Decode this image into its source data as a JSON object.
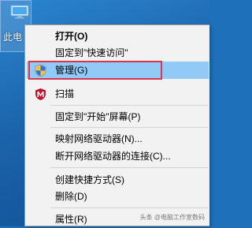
{
  "desktop": {
    "icon_label": "此电",
    "icon_name": "this-pc-icon"
  },
  "menu": {
    "items": [
      {
        "label": "打开(O)",
        "bold": true
      },
      {
        "label": "固定到\"快速访问\""
      },
      {
        "label": "管理(G)",
        "icon": "shield-icon",
        "highlighted": true
      },
      {
        "label": "扫描",
        "icon": "antivirus-icon"
      },
      {
        "label": "固定到\"开始\"屏幕(P)"
      },
      {
        "label": "映射网络驱动器(N)..."
      },
      {
        "label": "断开网络驱动器的连接(C)..."
      },
      {
        "label": "创建快捷方式(S)"
      },
      {
        "label": "删除(D)"
      },
      {
        "label": "属性(R)"
      }
    ]
  },
  "watermark": "头条 @电脑工作室数码",
  "colors": {
    "highlight": "#91c9f7",
    "annotation_box": "#d9354c",
    "desktop": "#1d70b9"
  }
}
